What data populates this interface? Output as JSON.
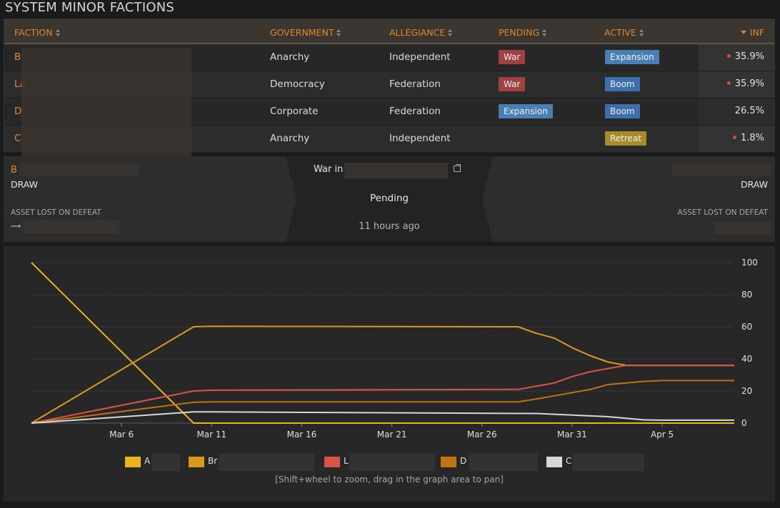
{
  "page_title": "SYSTEM MINOR FACTIONS",
  "table": {
    "headers": {
      "faction": "FACTION",
      "government": "GOVERNMENT",
      "allegiance": "ALLEGIANCE",
      "pending": "PENDING",
      "active": "ACTIVE",
      "inf": "INF"
    },
    "rows": [
      {
        "faction": "B",
        "government": "Anarchy",
        "allegiance": "Independent",
        "pending": "War",
        "active": "Expansion",
        "inf": "35.9%"
      },
      {
        "faction": "La",
        "government": "Democracy",
        "allegiance": "Federation",
        "pending": "War",
        "active": "Boom",
        "inf": "35.9%"
      },
      {
        "faction": "D",
        "government": "Corporate",
        "allegiance": "Federation",
        "pending": "Expansion",
        "active": "Boom",
        "inf": "26.5%"
      },
      {
        "faction": "C",
        "government": "Anarchy",
        "allegiance": "Independent",
        "pending": "",
        "active": "Retreat",
        "inf": "1.8%"
      }
    ]
  },
  "war": {
    "left_faction": "B",
    "left_result": "DRAW",
    "left_asset_label": "ASSET LOST ON DEFEAT",
    "title": "War in",
    "status": "Pending",
    "time": "11 hours ago",
    "right_result": "DRAW",
    "right_asset_label": "ASSET LOST ON DEFEAT"
  },
  "chart_data": {
    "type": "line",
    "x_ticks": [
      "Mar 6",
      "Mar 11",
      "Mar 16",
      "Mar 21",
      "Mar 26",
      "Mar 31",
      "Apr 5"
    ],
    "y_ticks": [
      "0",
      "20",
      "40",
      "60",
      "80",
      "100"
    ],
    "ylim": [
      0,
      100
    ],
    "x": [
      "Mar 1",
      "Mar 10",
      "Mar 11",
      "Mar 28",
      "Mar 29",
      "Mar 30",
      "Mar 31",
      "Apr 1",
      "Apr 2",
      "Apr 3",
      "Apr 4",
      "Apr 5",
      "Apr 9"
    ],
    "series": [
      {
        "name": "A",
        "color": "#e8b420",
        "values": [
          100,
          0,
          0,
          0,
          0,
          0,
          0,
          0,
          0,
          0,
          0,
          0,
          0
        ]
      },
      {
        "name": "Br",
        "color": "#d89a1e",
        "values": [
          0,
          60,
          60.3,
          60,
          56,
          53,
          47,
          42,
          38,
          36,
          36,
          36,
          36
        ]
      },
      {
        "name": "L",
        "color": "#d9554a",
        "values": [
          0,
          20,
          20.5,
          21,
          23,
          25,
          29,
          32,
          34,
          35.9,
          35.9,
          35.9,
          35.9
        ]
      },
      {
        "name": "D",
        "color": "#c07411",
        "values": [
          0,
          13,
          13.2,
          13.2,
          15,
          17,
          19,
          21,
          24,
          25,
          26,
          26.5,
          26.5
        ]
      },
      {
        "name": "C",
        "color": "#d8d8d8",
        "values": [
          0,
          7,
          7,
          6,
          6,
          5.5,
          5,
          4.5,
          4,
          3,
          2,
          1.8,
          1.8
        ]
      }
    ],
    "legend": [
      "A",
      "Br",
      "L",
      "D",
      "C"
    ],
    "grid": true,
    "legend_position": "bottom",
    "hint": "[Shift+wheel to zoom, drag in the graph area to pan]"
  }
}
